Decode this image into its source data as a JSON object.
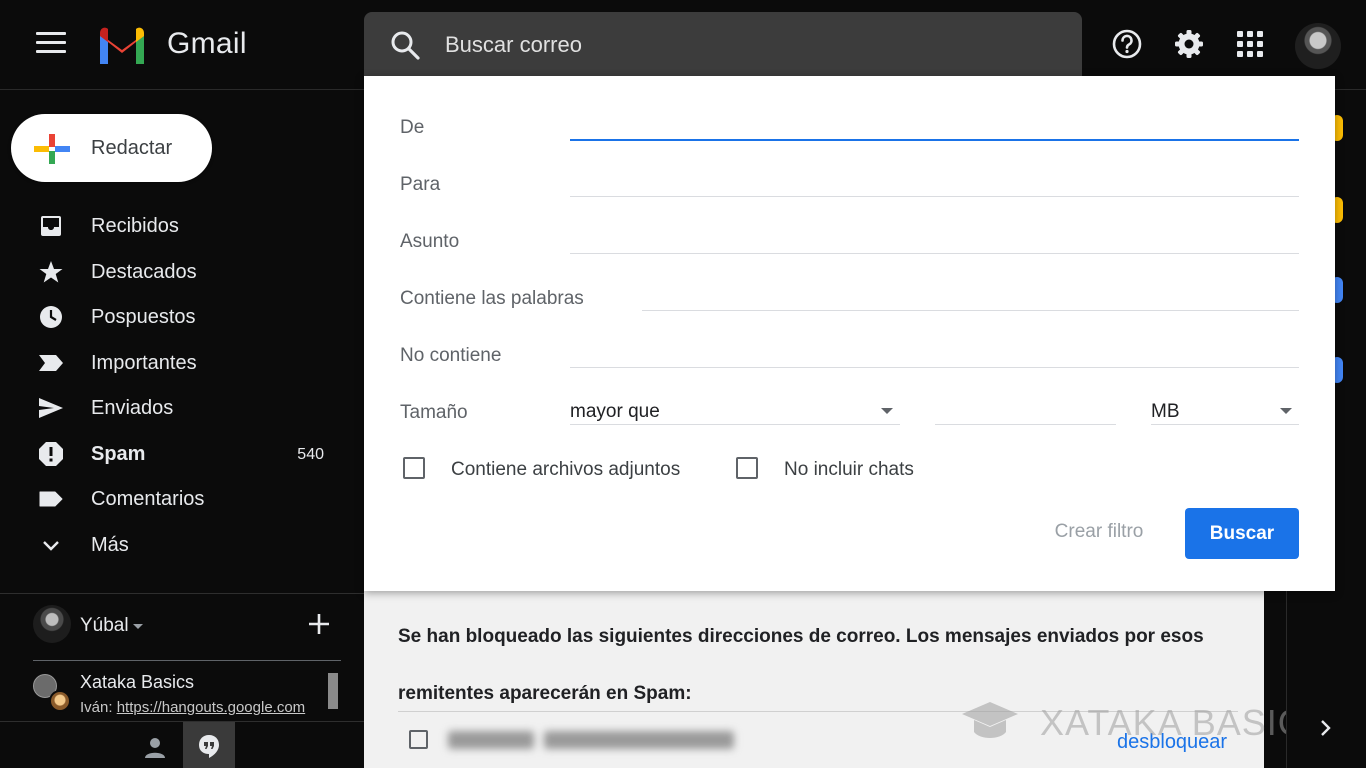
{
  "header": {
    "app_name": "Gmail",
    "search_placeholder": "Buscar correo"
  },
  "sidebar": {
    "compose_label": "Redactar",
    "items": [
      {
        "label": "Recibidos",
        "icon": "inbox-icon"
      },
      {
        "label": "Destacados",
        "icon": "star-icon"
      },
      {
        "label": "Pospuestos",
        "icon": "clock-icon"
      },
      {
        "label": "Importantes",
        "icon": "important-icon"
      },
      {
        "label": "Enviados",
        "icon": "send-icon"
      },
      {
        "label": "Spam",
        "icon": "spam-icon",
        "count": "540"
      },
      {
        "label": "Comentarios",
        "icon": "label-icon"
      },
      {
        "label": "Más",
        "icon": "chevron-down-icon"
      }
    ],
    "hangouts": {
      "user_name": "Yúbal",
      "chat_name": "Xataka Basics",
      "chat_sender": "Iván:",
      "chat_link": "https://hangouts.google.com"
    }
  },
  "search_options": {
    "from_label": "De",
    "to_label": "Para",
    "subject_label": "Asunto",
    "has_words_label": "Contiene las palabras",
    "not_has_label": "No contiene",
    "size_label": "Tamaño",
    "size_operator": "mayor que",
    "size_unit": "MB",
    "attachments_label": "Contiene archivos adjuntos",
    "no_chats_label": "No incluir chats",
    "create_filter_label": "Crear filtro",
    "search_button_label": "Buscar"
  },
  "main": {
    "blocked_notice": "Se han bloqueado las siguientes direcciones de correo. Los mensajes enviados por esos remitentes aparecerán en Spam:",
    "unblock_label": "desbloquear"
  },
  "watermark": "XATAKA BASICS",
  "colors": {
    "accent": "#1a73e8",
    "background": "#0b0b0b",
    "panel": "#ffffff"
  }
}
